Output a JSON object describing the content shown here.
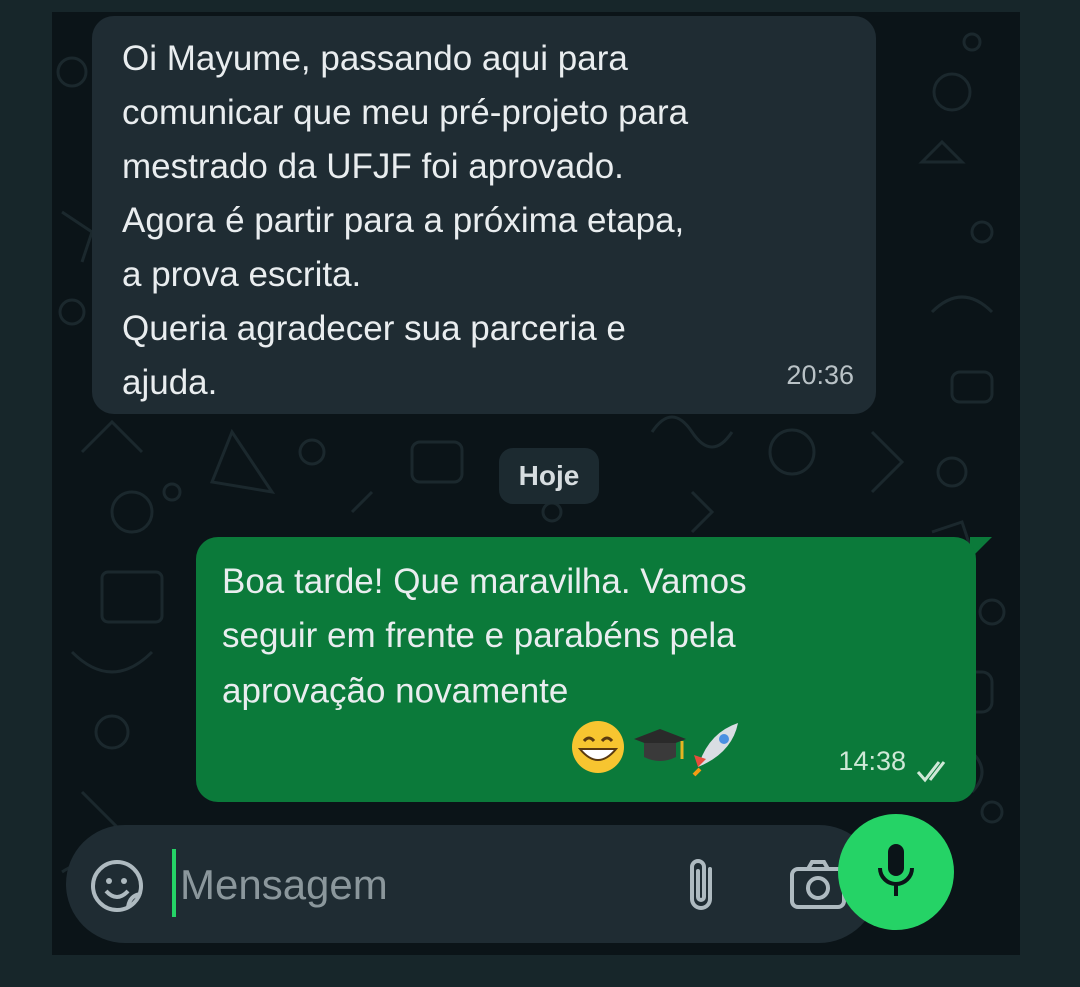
{
  "colors": {
    "background": "#0b1418",
    "incoming_bubble": "#1f2c33",
    "outgoing_bubble": "#0b7a3a",
    "accent": "#25d366",
    "text": "#e9edef"
  },
  "messages": [
    {
      "direction": "incoming",
      "text": "Oi Mayume, passando aqui para\ncomunicar que meu pré-projeto para\nmestrado da UFJF foi aprovado.\nAgora é partir para a próxima etapa,\na prova escrita.\nQueria agradecer sua parceria e\najuda.",
      "time": "20:36"
    },
    {
      "direction": "outgoing",
      "text": "Boa tarde! Que maravilha. Vamos\nseguir em frente e parabéns pela\naprovação novamente",
      "emojis": [
        "grinning-face",
        "graduation-cap",
        "rocket"
      ],
      "time": "14:38",
      "status": "read-double-check-icon"
    }
  ],
  "date_separator": "Hoje",
  "composer": {
    "placeholder": "Mensagem",
    "icons": [
      "sticker-icon",
      "paperclip-icon",
      "camera-icon",
      "microphone-icon"
    ]
  }
}
